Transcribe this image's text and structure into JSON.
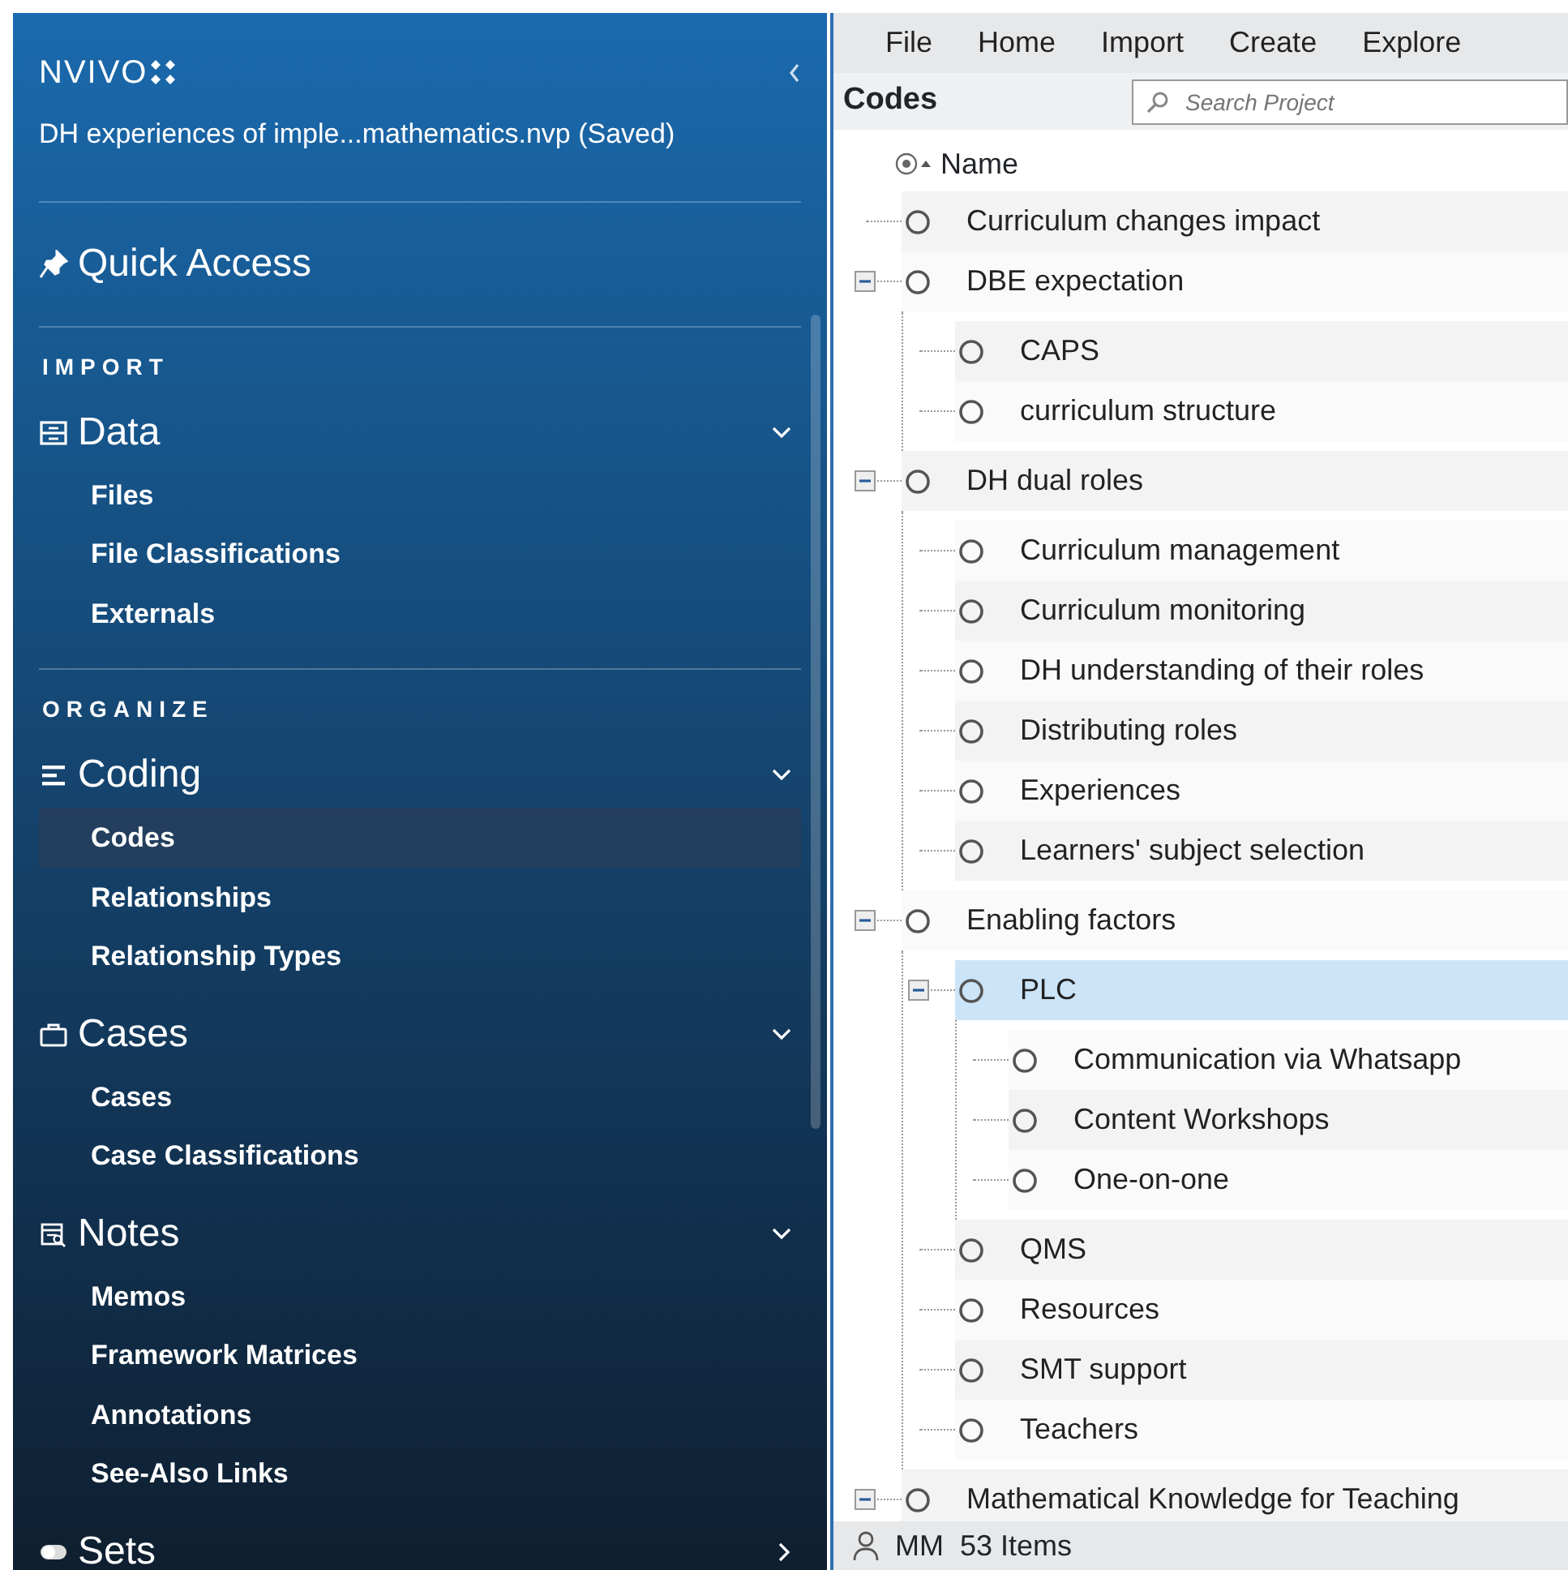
{
  "app": {
    "logo": "NVIVO",
    "project": "DH experiences of imple...mathematics.nvp (Saved)"
  },
  "sidebar": {
    "quick_access": "Quick Access",
    "sections": [
      {
        "heading": "IMPORT",
        "groups": [
          {
            "title": "Data",
            "kind": "data",
            "expanded": true,
            "items": [
              {
                "label": "Files",
                "selected": false
              },
              {
                "label": "File Classifications",
                "selected": false
              },
              {
                "label": "Externals",
                "selected": false
              }
            ]
          }
        ]
      },
      {
        "heading": "ORGANIZE",
        "groups": [
          {
            "title": "Coding",
            "kind": "coding",
            "expanded": true,
            "items": [
              {
                "label": "Codes",
                "selected": true
              },
              {
                "label": "Relationships",
                "selected": false
              },
              {
                "label": "Relationship Types",
                "selected": false
              }
            ]
          },
          {
            "title": "Cases",
            "kind": "cases",
            "expanded": true,
            "items": [
              {
                "label": "Cases",
                "selected": false
              },
              {
                "label": "Case Classifications",
                "selected": false
              }
            ]
          },
          {
            "title": "Notes",
            "kind": "notes",
            "expanded": true,
            "items": [
              {
                "label": "Memos",
                "selected": false
              },
              {
                "label": "Framework Matrices",
                "selected": false
              },
              {
                "label": "Annotations",
                "selected": false
              },
              {
                "label": "See-Also Links",
                "selected": false
              }
            ]
          },
          {
            "title": "Sets",
            "kind": "sets",
            "expanded": false
          }
        ]
      }
    ]
  },
  "ribbon": {
    "tabs": [
      "File",
      "Home",
      "Import",
      "Create",
      "Explore"
    ]
  },
  "list_view": {
    "title": "Codes",
    "search": {
      "placeholder": "Search Project"
    },
    "column": "Name"
  },
  "tree": {
    "nodes": [
      {
        "label": "Curriculum changes impact",
        "selected": false
      },
      {
        "label": "DBE expectation",
        "selected": false,
        "expanded": true,
        "children": [
          {
            "label": "CAPS",
            "selected": false
          },
          {
            "label": "curriculum structure",
            "selected": false
          }
        ]
      },
      {
        "label": "DH dual roles",
        "selected": false,
        "expanded": true,
        "children": [
          {
            "label": "Curriculum management",
            "selected": false
          },
          {
            "label": "Curriculum monitoring",
            "selected": false
          },
          {
            "label": "DH understanding of their roles",
            "selected": false
          },
          {
            "label": "Distributing roles",
            "selected": false
          },
          {
            "label": "Experiences",
            "selected": false
          },
          {
            "label": "Learners' subject selection",
            "selected": false
          }
        ]
      },
      {
        "label": "Enabling factors",
        "selected": false,
        "expanded": true,
        "children": [
          {
            "label": "PLC",
            "selected": true,
            "expanded": true,
            "children": [
              {
                "label": "Communication via Whatsapp",
                "selected": false
              },
              {
                "label": "Content Workshops",
                "selected": false
              },
              {
                "label": "One-on-one",
                "selected": false
              }
            ]
          },
          {
            "label": "QMS",
            "selected": false
          },
          {
            "label": "Resources",
            "selected": false
          },
          {
            "label": "SMT support",
            "selected": false
          },
          {
            "label": "Teachers",
            "selected": false
          }
        ]
      },
      {
        "label": "Mathematical Knowledge for Teaching",
        "selected": false,
        "expanded": true
      }
    ]
  },
  "status_bar": {
    "user": "MM",
    "count": "53 Items"
  }
}
